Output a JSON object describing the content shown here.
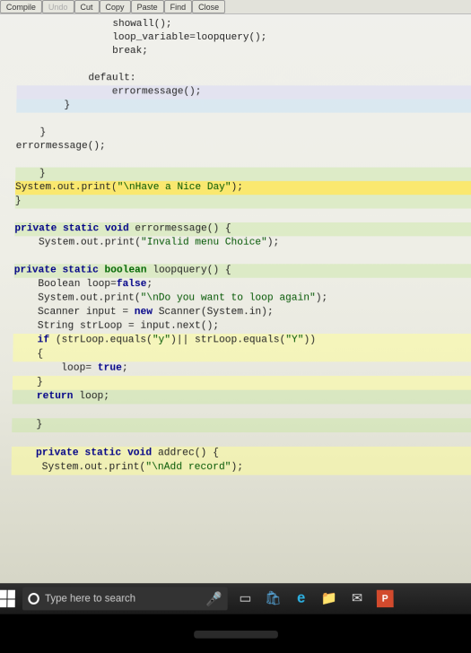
{
  "toolbar": {
    "compile": "Compile",
    "undo": "Undo",
    "cut": "Cut",
    "copy": "Copy",
    "paste": "Paste",
    "find": "Find",
    "close": "Close"
  },
  "code": {
    "l1": "                showall();",
    "l2": "                loop_variable=loopquery();",
    "l3": "                break;",
    "l4": "",
    "l5": "            default:",
    "l6": "                errormessage();",
    "l7": "        }",
    "l8": "",
    "l9": "    }",
    "l10": "errormessage();",
    "l11": "",
    "l12": "    }",
    "l13a": "System.out.print(",
    "l13b": "\"\\nHave a Nice Day\"",
    "l13c": ");",
    "l14": "}",
    "l15": "",
    "l16a": "private",
    "l16b": " static",
    "l16c": " void",
    "l16d": " errormessage() {",
    "l17a": "    System.out.print(",
    "l17b": "\"Invalid menu Choice\"",
    "l17c": ");",
    "l18": "",
    "l19a": "private",
    "l19b": " static",
    "l19c": " boolean",
    "l19d": " loopquery() {",
    "l20a": "    Boolean loop=",
    "l20b": "false",
    "l20c": ";",
    "l21a": "    System.out.print(",
    "l21b": "\"\\nDo you want to loop again\"",
    "l21c": ");",
    "l22a": "    Scanner input = ",
    "l22b": "new",
    "l22c": " Scanner(System.in);",
    "l23": "    String strLoop = input.next();",
    "l24a": "    if",
    "l24b": " (strLoop.equals(",
    "l24c": "\"y\"",
    "l24d": ")|| strLoop.equals(",
    "l24e": "\"Y\"",
    "l24f": "))",
    "l25": "    {",
    "l26a": "        loop= ",
    "l26b": "true",
    "l26c": ";",
    "l27": "    }",
    "l28a": "    return",
    "l28b": " loop;",
    "l29": "",
    "l30": "    }",
    "l31": "",
    "l32a": "    private",
    "l32b": " static",
    "l32c": " void",
    "l32d": " addrec() {",
    "l33a": "     System.out.print(",
    "l33b": "\"\\nAdd record\"",
    "l33c": ");"
  },
  "taskbar": {
    "search_placeholder": "Type here to search",
    "ppt": "P"
  }
}
